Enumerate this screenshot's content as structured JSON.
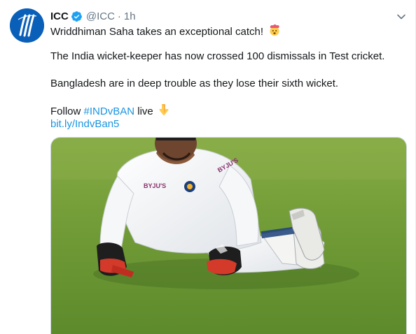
{
  "tweet": {
    "display_name": "ICC",
    "handle": "@ICC",
    "separator": "·",
    "time": "1h",
    "lines": {
      "line1": "Wriddhiman Saha takes an exceptional catch!",
      "line2": "The India wicket-keeper has now crossed 100 dismissals in Test cricket.",
      "line3": "Bangladesh are in deep trouble as they lose their sixth wicket.",
      "follow_prefix": "Follow",
      "hashtag": "#INDvBAN",
      "follow_suffix": "live",
      "url": "bit.ly/IndvBan5"
    },
    "media": {
      "description_icon": "cricket-photo",
      "shirt_text": "BYJU'S"
    }
  },
  "colors": {
    "link": "#1b95e0",
    "secondary_text": "#657786",
    "verified": "#1da1f2",
    "avatar_blue": "#0a5fb8",
    "grass": "#6f9a35"
  },
  "icons": {
    "verified": "verified-badge-icon",
    "caret": "chevron-down-icon",
    "emoji_exploding": "exploding-head-emoji",
    "emoji_pointing": "backhand-index-pointing-down-emoji"
  }
}
